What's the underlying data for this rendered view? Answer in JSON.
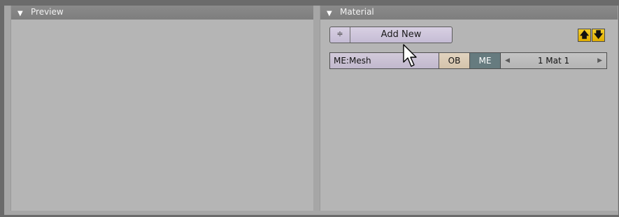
{
  "preview_panel": {
    "title": "Preview"
  },
  "material_panel": {
    "title": "Material",
    "add_new_label": "Add New",
    "link_field_value": "ME:Mesh",
    "ob_label": "OB",
    "me_label": "ME",
    "material_index_value": "1 Mat 1",
    "icons": {
      "collapse": "triangle-down-icon",
      "spin": "up-down-spinner-icon",
      "pin_up": "arrow-up-icon",
      "pin_down": "arrow-down-icon",
      "prev": "arrow-left-icon",
      "next": "arrow-right-icon",
      "cursor": "mouse-cursor-icon"
    },
    "colors": {
      "me_active": "#667b7f",
      "ob_button": "#d9ccb7",
      "pin_buttons": "#e8bb10"
    }
  }
}
